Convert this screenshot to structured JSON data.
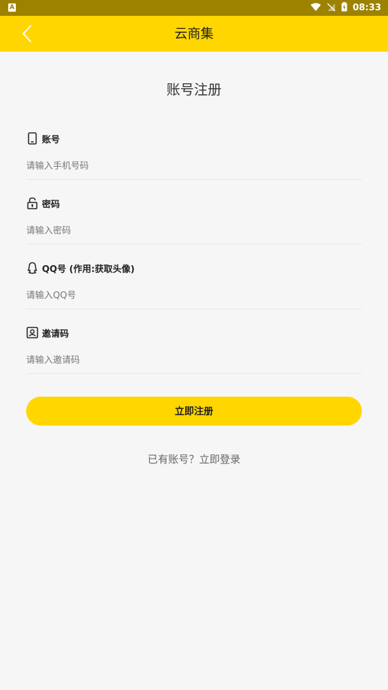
{
  "status_bar": {
    "notification_icon_label": "A",
    "time": "08:33"
  },
  "app_bar": {
    "title": "云商集"
  },
  "page": {
    "title": "账号注册"
  },
  "fields": [
    {
      "label": "账号",
      "placeholder": "请输入手机号码",
      "value": "",
      "icon": "phone-icon"
    },
    {
      "label": "密码",
      "placeholder": "请输入密码",
      "value": "",
      "icon": "lock-icon"
    },
    {
      "label": "QQ号 (作用:获取头像)",
      "placeholder": "请输入QQ号",
      "value": "",
      "icon": "qq-icon"
    },
    {
      "label": "邀请码",
      "placeholder": "请输入邀请码",
      "value": "",
      "icon": "contact-card-icon"
    }
  ],
  "register_button_label": "立即注册",
  "login_prompt": "已有账号？",
  "login_link_label": "立即登录",
  "colors": {
    "accent": "#ffd600",
    "status_bar": "#9d8200",
    "background": "#f6f6f6"
  }
}
